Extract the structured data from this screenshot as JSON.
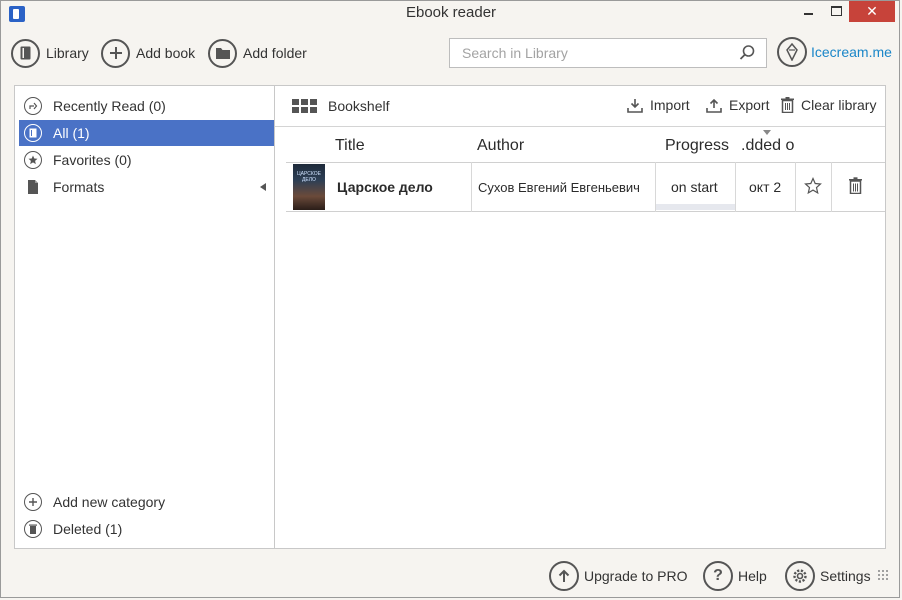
{
  "window": {
    "title": "Ebook reader",
    "controls": {
      "minimize": "minimize-icon",
      "maximize": "maximize-icon",
      "close": "✕"
    }
  },
  "toolbar": {
    "library_label": "Library",
    "add_book_label": "Add book",
    "add_folder_label": "Add folder",
    "search": {
      "placeholder": "Search in Library",
      "value": ""
    },
    "brand_link": "Icecream.me"
  },
  "sidebar": {
    "items": [
      {
        "label": "Recently Read (0)",
        "icon": "recent-icon"
      },
      {
        "label": "All (1)",
        "icon": "book-icon",
        "active": true
      },
      {
        "label": "Favorites (0)",
        "icon": "star-icon"
      },
      {
        "label": "Formats",
        "icon": "file-icon"
      }
    ],
    "bottom": [
      {
        "label": "Add new category",
        "icon": "plus-icon"
      },
      {
        "label": "Deleted (1)",
        "icon": "trash-icon"
      }
    ]
  },
  "main": {
    "view_label": "Bookshelf",
    "actions": {
      "import": "Import",
      "export": "Export",
      "clear": "Clear library"
    },
    "columns": {
      "title": "Title",
      "author": "Author",
      "progress": "Progress",
      "added": ".dded o"
    },
    "rows": [
      {
        "cover_text": "ЦАРСКОЕ ДЕЛО",
        "title": "Царское дело",
        "author": "Сухов Евгений Евгеньевич",
        "progress": "on start",
        "added": "окт 2"
      }
    ]
  },
  "footer": {
    "upgrade": "Upgrade to PRO",
    "help": "Help",
    "settings": "Settings"
  },
  "colors": {
    "accent": "#4a72c6",
    "link": "#1a86c8",
    "close": "#c7433a",
    "background": "#f6f4f0"
  }
}
